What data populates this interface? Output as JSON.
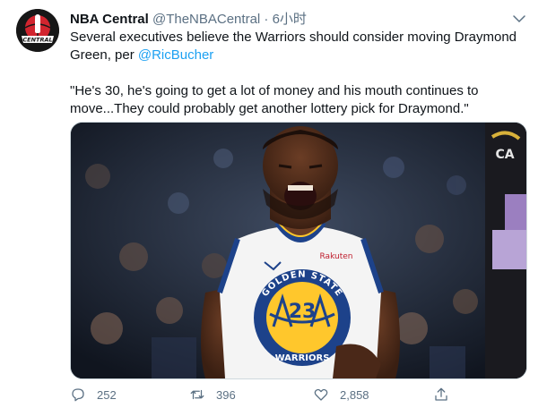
{
  "author": {
    "name": "NBA Central",
    "handle": "@TheNBACentral",
    "separator": "·",
    "time": "6小时",
    "avatar_text": "CENTRAL"
  },
  "tweet": {
    "line1": "Several executives believe the Warriors should consider moving Draymond Green, per ",
    "mention": "@RicBucher",
    "quote": "\"He's 30, he's going to get a lot of money and his mouth continues to move...They could probably get another lottery pick for Draymond.\""
  },
  "media": {
    "jersey_text": "GOLDEN STATE",
    "jersey_number": "23",
    "jersey_sponsor": "Rakuten",
    "jersey_team_bottom": "WARRIORS",
    "arena_sign": "CA"
  },
  "actions": {
    "reply_count": "252",
    "retweet_count": "396",
    "like_count": "2,858"
  },
  "colors": {
    "link": "#1da1f2",
    "muted": "#5b7083",
    "jersey_blue": "#1d428a",
    "jersey_gold": "#ffc72c"
  }
}
